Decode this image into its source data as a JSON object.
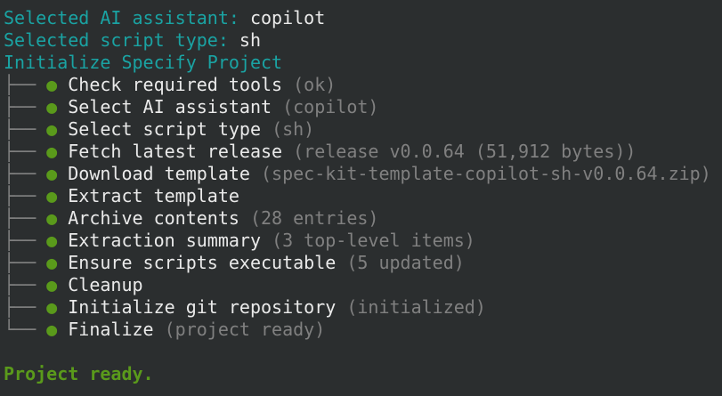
{
  "header": {
    "assistant_label": "Selected AI assistant:",
    "assistant_value": "copilot",
    "script_label": "Selected script type:",
    "script_value": "sh",
    "title": "Initialize Specify Project"
  },
  "tree": {
    "branch": "├──",
    "last_branch": "└──",
    "bullet": "●"
  },
  "steps": [
    {
      "label": "Check required tools",
      "detail": "(ok)"
    },
    {
      "label": "Select AI assistant",
      "detail": "(copilot)"
    },
    {
      "label": "Select script type",
      "detail": "(sh)"
    },
    {
      "label": "Fetch latest release",
      "detail": "(release v0.0.64 (51,912 bytes))"
    },
    {
      "label": "Download template",
      "detail": "(spec-kit-template-copilot-sh-v0.0.64.zip)"
    },
    {
      "label": "Extract template",
      "detail": ""
    },
    {
      "label": "Archive contents",
      "detail": "(28 entries)"
    },
    {
      "label": "Extraction summary",
      "detail": "(3 top-level items)"
    },
    {
      "label": "Ensure scripts executable",
      "detail": "(5 updated)"
    },
    {
      "label": "Cleanup",
      "detail": ""
    },
    {
      "label": "Initialize git repository",
      "detail": "(initialized)"
    },
    {
      "label": "Finalize",
      "detail": "(project ready)"
    }
  ],
  "footer": {
    "status": "Project ready."
  },
  "colors": {
    "background": "#2b2e2f",
    "teal": "#1aa3a3",
    "bullet_green": "#5a9a1b",
    "dim": "#808080"
  }
}
